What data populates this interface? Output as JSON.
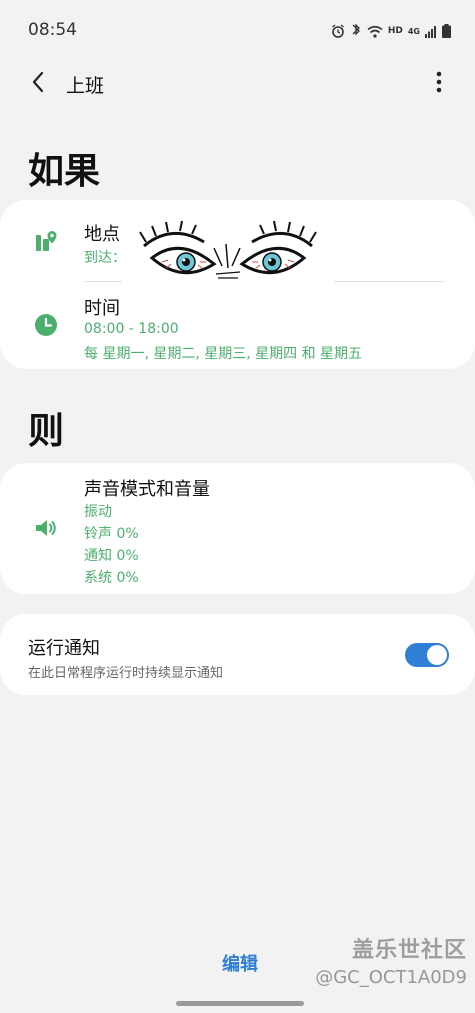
{
  "status_bar": {
    "time": "08:54",
    "hd_label": "HD",
    "network_label": "4G",
    "icons": [
      "alarm-icon",
      "bluetooth-charging-icon",
      "wifi-icon",
      "signal-icon",
      "battery-icon"
    ]
  },
  "header": {
    "title": "上班",
    "back_icon": "chevron-left-icon",
    "more_icon": "more-vert-icon"
  },
  "if_section": {
    "title": "如果",
    "location": {
      "icon": "location-icon",
      "title": "地点",
      "subtitle": "到达："
    },
    "time": {
      "icon": "clock-icon",
      "title": "时间",
      "range": "08:00 - 18:00",
      "repeat": "每 星期一, 星期二, 星期三, 星期四 和 星期五"
    }
  },
  "then_section": {
    "title": "则",
    "sound": {
      "icon": "volume-icon",
      "title": "声音模式和音量",
      "lines": [
        "振动",
        "铃声 0%",
        "通知 0%",
        "系统 0%"
      ]
    }
  },
  "notification": {
    "title": "运行通知",
    "subtitle": "在此日常程序运行时持续显示通知",
    "enabled": true
  },
  "footer": {
    "edit_label": "编辑",
    "watermark": "盖乐世社区",
    "watermark_id": "@GC_OCT1A0D9"
  },
  "colors": {
    "accent_green": "#4caf6e",
    "accent_blue": "#2f7fd6",
    "background": "#f2f2f2",
    "card": "#ffffff"
  }
}
